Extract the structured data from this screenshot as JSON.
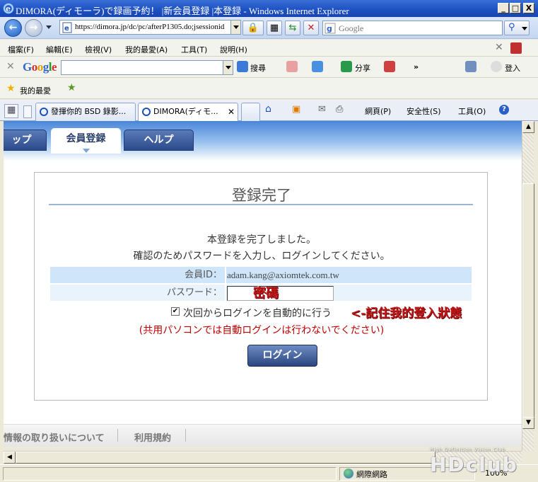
{
  "window": {
    "title": "DIMORA(ディモーラ)で録画予約！ |新会員登録 |本登録 - Windows Internet Explorer",
    "minimize": "_",
    "maximize": "□",
    "close": "X"
  },
  "address": {
    "url": "https://dimora.jp/dc/pc/afterP1305.do;jsessionid",
    "search_placeholder": "Google"
  },
  "menu": [
    "檔案(F)",
    "編輯(E)",
    "檢視(V)",
    "我的最愛(A)",
    "工具(T)",
    "說明(H)"
  ],
  "google_toolbar": {
    "logo": "Google",
    "search_label": "搜尋",
    "share_label": "分享",
    "more": "»",
    "login_label": "登入"
  },
  "favorites": {
    "label": "我的最愛"
  },
  "tabs": [
    {
      "label": "發揮你的 BSD 錄影..."
    },
    {
      "label": "DIMORA(ディモ..."
    }
  ],
  "command_bar": {
    "page": "網頁(P)",
    "safety": "安全性(S)",
    "tools": "工具(O)"
  },
  "site_nav": {
    "tabs": [
      "ップ",
      "会員登録",
      "ヘルプ"
    ]
  },
  "panel": {
    "title": "登録完了",
    "message1": "本登録を完了しました。",
    "message2": "確認のためパスワードを入力し、ログインしてください。",
    "member_id_label": "会員ID：",
    "member_id_value": "adam.kang@axiomtek.com.tw",
    "password_label": "パスワード：",
    "password_note": "密碼",
    "remember_label": "次回からログインを自動的に行う",
    "remember_note": "<-記住我的登入狀態",
    "remember_checked": "✔",
    "notice": "(共用パソコンでは自動ログインは行わないでください)",
    "login_button": "ログイン"
  },
  "footer": {
    "links": [
      "情報の取り扱いについて",
      "利用規約"
    ]
  },
  "status": {
    "zone": "網際網路",
    "zoom": "100%"
  },
  "watermark": {
    "logo": "HDclub",
    "tag": "High Definition Vision Club"
  },
  "colors": {
    "accent": "#1c4fc0",
    "notice": "#c00000",
    "annotation": "#c01818"
  }
}
